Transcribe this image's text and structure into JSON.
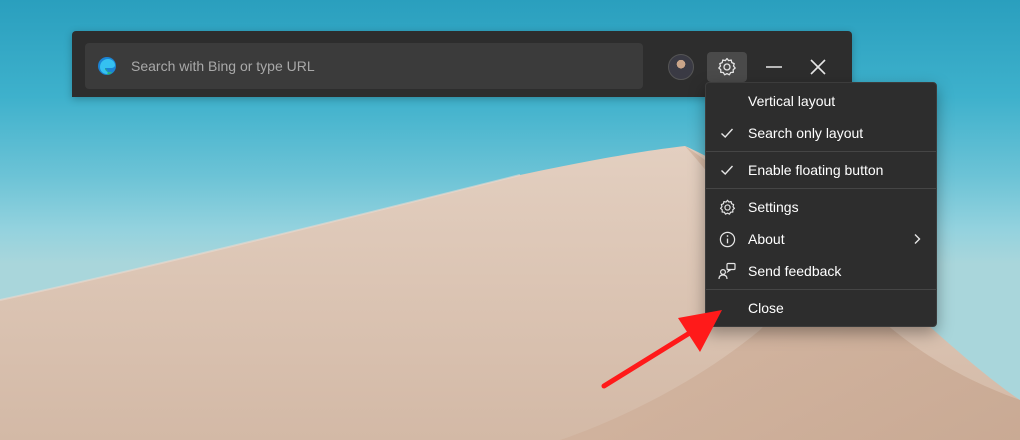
{
  "search": {
    "placeholder": "Search with Bing or type URL"
  },
  "menu": {
    "items": [
      {
        "label": "Vertical layout",
        "checked": false
      },
      {
        "label": "Search only layout",
        "checked": true
      },
      {
        "label": "Enable floating button",
        "checked": true
      },
      {
        "label": "Settings",
        "icon": "gear-icon"
      },
      {
        "label": "About",
        "icon": "info-icon",
        "submenu": true
      },
      {
        "label": "Send feedback",
        "icon": "feedback-icon"
      },
      {
        "label": "Close"
      }
    ]
  },
  "colors": {
    "bar": "#2d2d2d",
    "search_field": "#3b3b3b",
    "menu": "#2d2d2d",
    "annotation_arrow": "#ff1a1a"
  }
}
